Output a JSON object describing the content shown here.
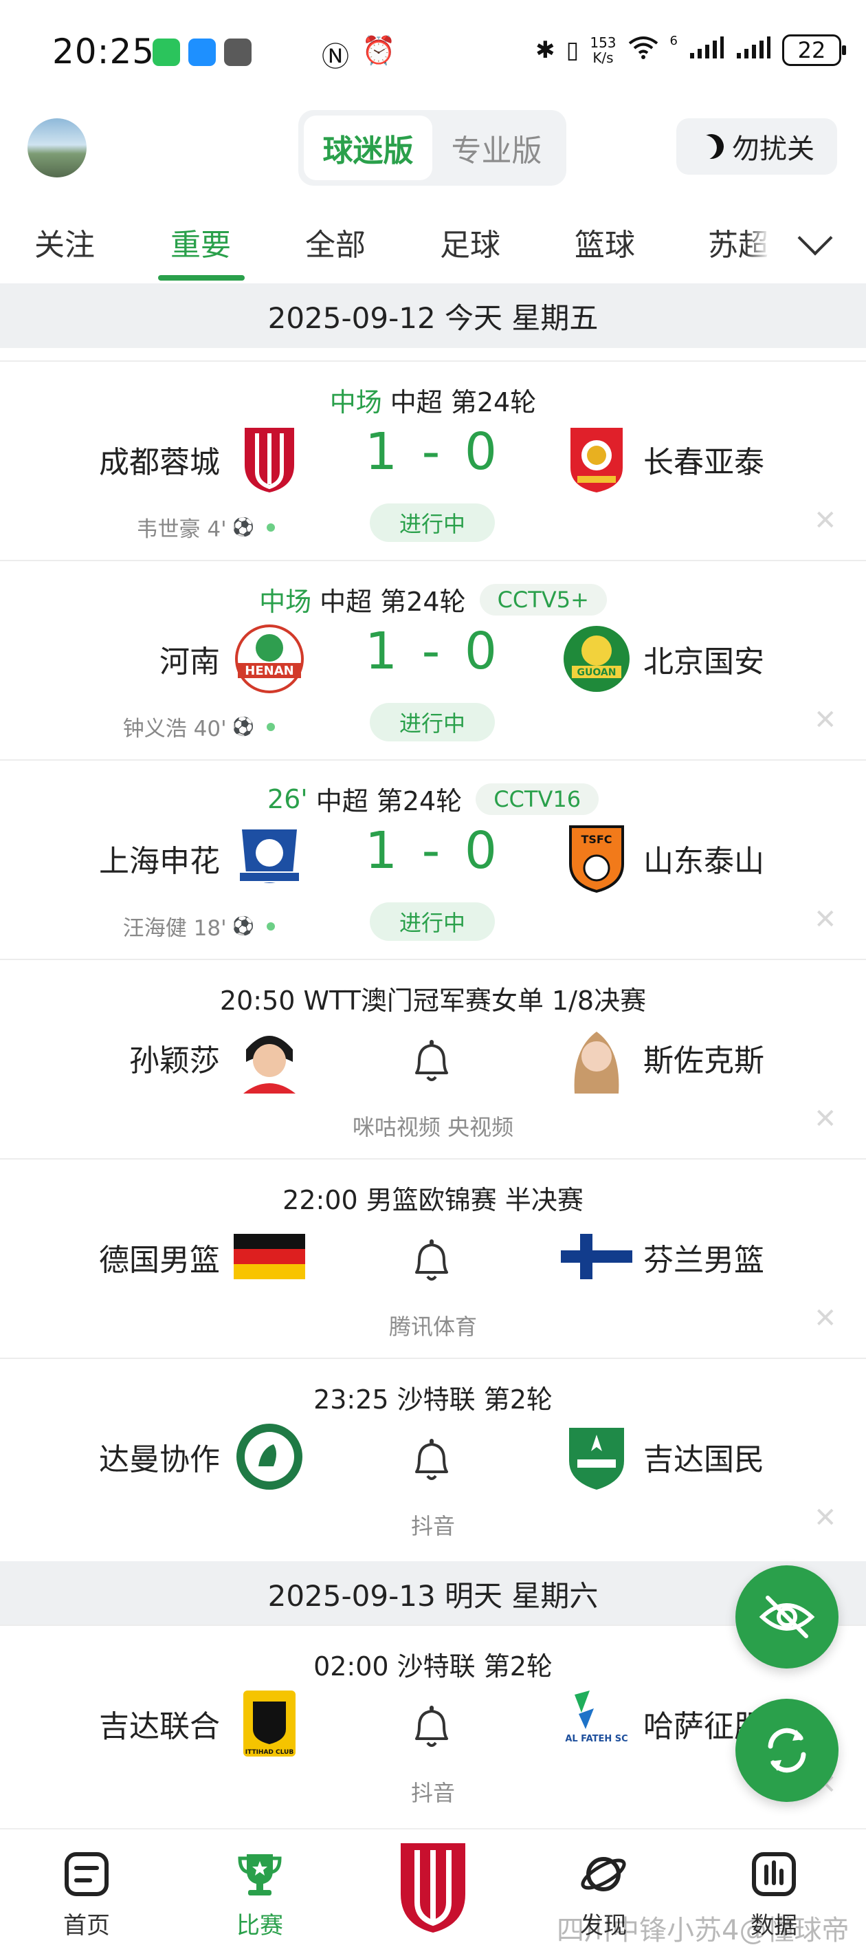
{
  "status_bar": {
    "time": "20:25",
    "net_speed_value": "153",
    "net_speed_unit": "K/s",
    "signal_superscript": "6",
    "battery": "22"
  },
  "header": {
    "mode_active": "球迷版",
    "mode_inactive": "专业版",
    "dnd_label": "勿扰关"
  },
  "tabs": [
    "关注",
    "重要",
    "全部",
    "足球",
    "篮球",
    "苏超"
  ],
  "active_tab": "重要",
  "dates": {
    "today": "2025-09-12 今天 星期五",
    "tomorrow": "2025-09-13 明天 星期六"
  },
  "matches": [
    {
      "minute": "中场",
      "league": "中超 第24轮",
      "tv": "",
      "home": "成都蓉城",
      "away": "长春亚泰",
      "score": "1 - 0",
      "status": "进行中",
      "scorer": "韦世豪 4'"
    },
    {
      "minute": "中场",
      "league": "中超 第24轮",
      "tv": "CCTV5+",
      "home": "河南",
      "away": "北京国安",
      "score": "1 - 0",
      "status": "进行中",
      "scorer": "钟义浩 40'"
    },
    {
      "minute": "26'",
      "league": "中超 第24轮",
      "tv": "CCTV16",
      "home": "上海申花",
      "away": "山东泰山",
      "score": "1 - 0",
      "status": "进行中",
      "scorer": "汪海健 18'"
    },
    {
      "title": "20:50 WTT澳门冠军赛女单 1/8决赛",
      "home": "孙颖莎",
      "away": "斯佐克斯",
      "channels": "咪咕视频 央视频"
    },
    {
      "title": "22:00 男篮欧锦赛 半决赛",
      "home": "德国男篮",
      "away": "芬兰男篮",
      "channels": "腾讯体育"
    },
    {
      "title": "23:25 沙特联 第2轮",
      "home": "达曼协作",
      "away": "吉达国民",
      "channels": "抖音"
    },
    {
      "title": "02:00 沙特联 第2轮",
      "home": "吉达联合",
      "away": "哈萨征服",
      "channels": "抖音"
    }
  ],
  "logo_text": {
    "henan": "HENAN",
    "guoan": "GUOAN",
    "tsfc": "TSFC",
    "ittihad": "ITTIHAD CLUB",
    "alfateh": "AL FATEH SC"
  },
  "bottom_nav": [
    {
      "label": "首页",
      "icon": "home-doc-icon"
    },
    {
      "label": "比赛",
      "icon": "trophy-icon"
    },
    {
      "label": "",
      "icon": "team-logo-icon"
    },
    {
      "label": "发现",
      "icon": "planet-icon"
    },
    {
      "label": "数据",
      "icon": "chart-icon"
    }
  ],
  "close_mark": "✕",
  "watermark": "四川中锋小苏4@懂球帝",
  "colors": {
    "accent": "#2aa04b",
    "background": "#ffffff",
    "separator": "#eef0f2"
  }
}
